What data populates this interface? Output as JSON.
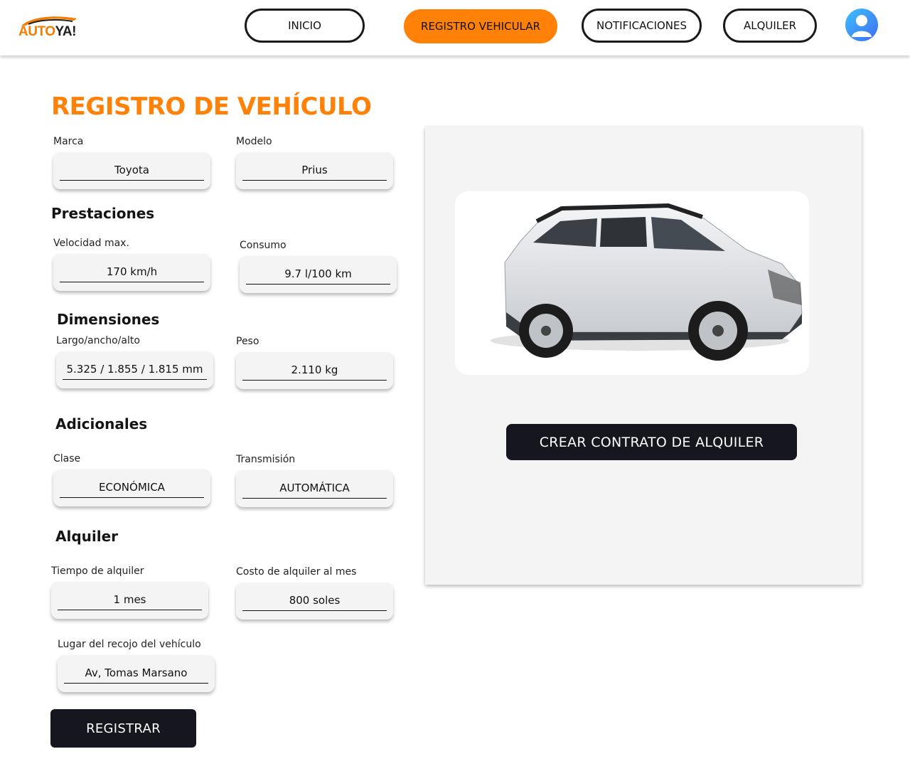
{
  "brand": {
    "logo_primary": "AUTO",
    "logo_secondary": "YA!",
    "accent": "#ff8107",
    "dark": "#16161f"
  },
  "nav": {
    "items": [
      {
        "label": "INICIO",
        "active": false
      },
      {
        "label": "REGISTRO VEHICULAR",
        "active": true
      },
      {
        "label": "NOTIFICACIONES",
        "active": false
      },
      {
        "label": "ALQUILER",
        "active": false
      }
    ],
    "avatar_icon": "user-avatar-icon"
  },
  "page": {
    "title": "REGISTRO DE VEHÍCULO"
  },
  "form": {
    "marca": {
      "label": "Marca",
      "value": "Toyota"
    },
    "modelo": {
      "label": "Modelo",
      "value": "Prius"
    },
    "prestaciones": "Prestaciones",
    "velocidad": {
      "label": "Velocidad max.",
      "value": "170 km/h"
    },
    "consumo": {
      "label": "Consumo",
      "value": "9.7 l/100 km"
    },
    "dimensiones": "Dimensiones",
    "largo": {
      "label": "Largo/ancho/alto",
      "value": "5.325 / 1.855 / 1.815 mm"
    },
    "peso": {
      "label": "Peso",
      "value": "2.110 kg"
    },
    "adicionales": "Adicionales",
    "clase": {
      "label": "Clase",
      "value": "ECONÓMICA"
    },
    "transmision": {
      "label": "Transmisión",
      "value": "AUTOMÁTICA"
    },
    "alquiler": "Alquiler",
    "tiempo": {
      "label": "Tiempo de alquiler",
      "value": "1 mes"
    },
    "costo": {
      "label": "Costo de alquiler al mes",
      "value": "800 soles"
    },
    "lugar": {
      "label": "Lugar del recojo del vehículo",
      "value": "Av, Tomas Marsano"
    },
    "submit_label": "REGISTRAR"
  },
  "panel": {
    "contract_button": "CREAR CONTRATO DE ALQUILER",
    "image_icon": "car-photo-icon"
  }
}
